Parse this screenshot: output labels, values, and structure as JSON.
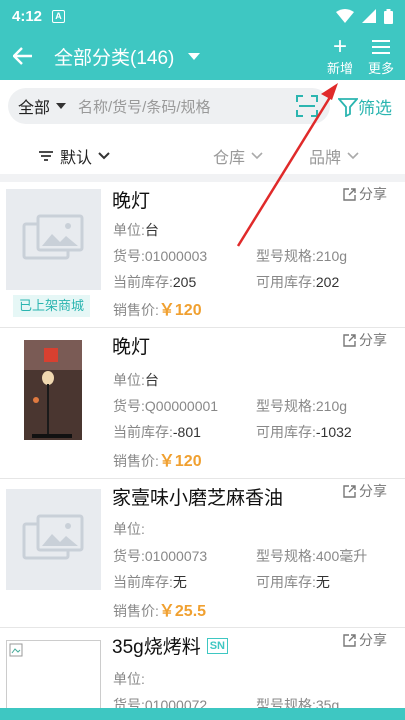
{
  "status_bar": {
    "time": "4:12",
    "notif_letter": "A"
  },
  "app_bar": {
    "back_icon": "arrow-left-icon",
    "title": "全部分类(146)",
    "add_label": "新增",
    "more_label": "更多"
  },
  "search": {
    "scope": "全部",
    "placeholder": "名称/货号/条码/规格",
    "filter_label": "筛选"
  },
  "sort": {
    "default_label": "默认",
    "warehouse_label": "仓库",
    "brand_label": "品牌"
  },
  "labels": {
    "unit": "单位:",
    "sku": "货号:",
    "spec": "型号规格:",
    "stock": "当前库存:",
    "available": "可用库存:",
    "price": "销售价:",
    "share": "分享"
  },
  "products": [
    {
      "name": "晚灯",
      "unit": "台",
      "sku": "01000003",
      "spec": "210g",
      "stock": "205",
      "available": "202",
      "price": "￥120",
      "badge": "已上架商城",
      "thumb": "placeholder"
    },
    {
      "name": "晚灯",
      "unit": "台",
      "sku": "Q00000001",
      "spec": "210g",
      "stock": "-801",
      "available": "-1032",
      "price": "￥120",
      "thumb": "photo"
    },
    {
      "name": "家壹味小磨芝麻香油",
      "unit": "",
      "sku": "01000073",
      "spec": "400毫升",
      "stock": "无",
      "available": "无",
      "price": "￥25.5",
      "thumb": "placeholder"
    },
    {
      "name": "35g烧烤料",
      "sn": "SN",
      "unit": "",
      "sku": "01000072",
      "spec": "35g",
      "thumb": "broken"
    }
  ],
  "colors": {
    "primary": "#3ec7c2",
    "price": "#f0a030",
    "arrow": "#e02a2a"
  }
}
